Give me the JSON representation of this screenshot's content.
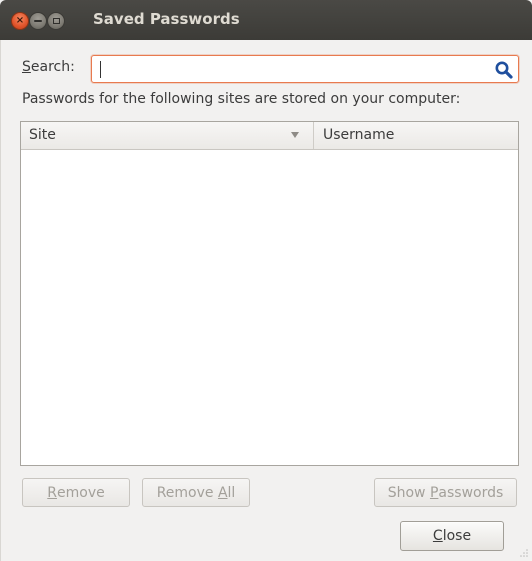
{
  "window": {
    "title": "Saved Passwords"
  },
  "search": {
    "label_mnemonic": "S",
    "label_rest": "earch:",
    "value": "",
    "placeholder": ""
  },
  "description": "Passwords for the following sites are stored on your computer:",
  "table": {
    "columns": [
      {
        "label": "Site",
        "sorted": "descending"
      },
      {
        "label": "Username"
      }
    ],
    "rows": []
  },
  "buttons": {
    "remove": {
      "mnemonic": "R",
      "rest": "emove",
      "enabled": false
    },
    "remove_all": {
      "before": "Remove ",
      "mnemonic": "A",
      "rest": "ll",
      "enabled": false
    },
    "show_passwords": {
      "before": "Show ",
      "mnemonic": "P",
      "rest": "asswords",
      "enabled": false
    },
    "close": {
      "mnemonic": "C",
      "rest": "lose",
      "enabled": true
    }
  },
  "colors": {
    "titlebar": "#3c3b37",
    "accent_focus": "#e87a4f",
    "window_bg": "#f2f1f0"
  },
  "icons": {
    "close": "close-icon",
    "minimize": "minimize-icon",
    "maximize": "maximize-icon",
    "search": "search-icon",
    "sort": "sort-descending-icon"
  }
}
